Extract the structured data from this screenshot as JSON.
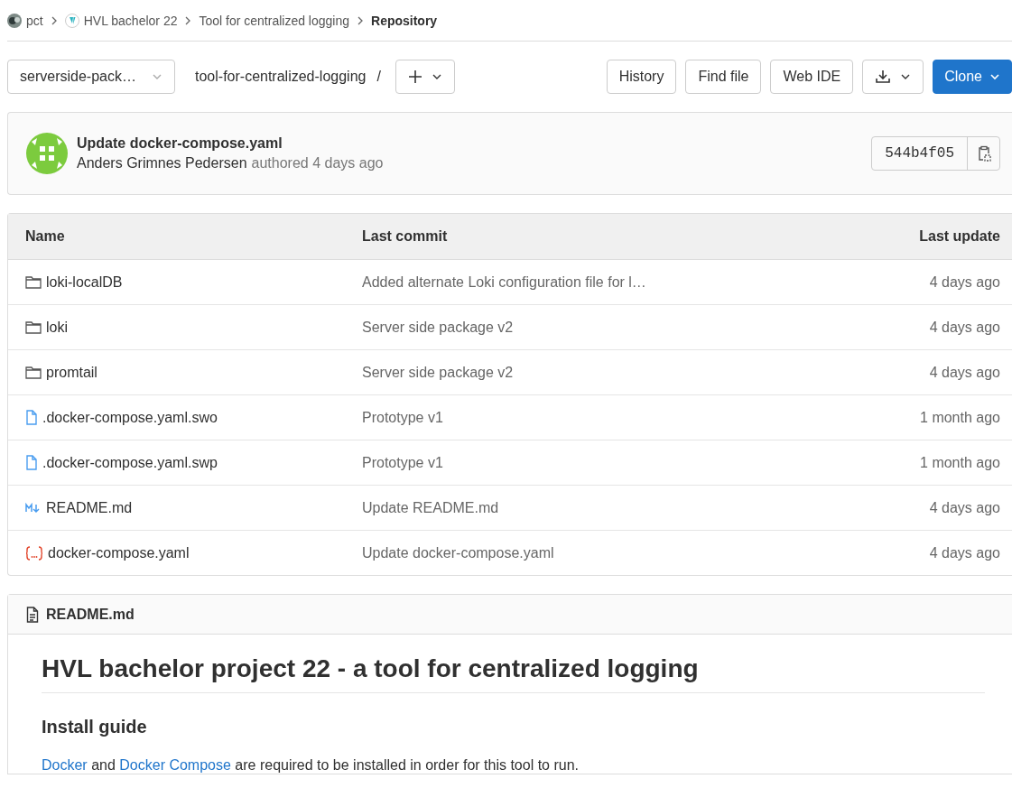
{
  "breadcrumbs": [
    {
      "label": "pct",
      "kind": "group",
      "current": false
    },
    {
      "label": "HVL bachelor 22",
      "kind": "project",
      "current": false
    },
    {
      "label": "Tool for centralized logging",
      "kind": "plain",
      "current": false
    },
    {
      "label": "Repository",
      "kind": "plain",
      "current": true
    }
  ],
  "toolbar": {
    "branch": "serverside-pack…",
    "path": "tool-for-centralized-logging",
    "separator": "/",
    "buttons": [
      "History",
      "Find file",
      "Web IDE"
    ],
    "clone": "Clone"
  },
  "commit": {
    "title": "Update docker-compose.yaml",
    "author": "Anders Grimnes Pedersen",
    "meta": "authored 4 days ago",
    "sha": "544b4f05"
  },
  "table": {
    "columns": [
      "Name",
      "Last commit",
      "Last update"
    ],
    "rows": [
      {
        "kind": "folder",
        "name": "loki-localDB",
        "commit": "Added alternate Loki configuration file for l…",
        "updated": "4 days ago"
      },
      {
        "kind": "folder",
        "name": "loki",
        "commit": "Server side package v2",
        "updated": "4 days ago"
      },
      {
        "kind": "folder",
        "name": "promtail",
        "commit": "Server side package v2",
        "updated": "4 days ago"
      },
      {
        "kind": "file",
        "name": ".docker-compose.yaml.swo",
        "commit": "Prototype v1",
        "updated": "1 month ago"
      },
      {
        "kind": "file",
        "name": ".docker-compose.yaml.swp",
        "commit": "Prototype v1",
        "updated": "1 month ago"
      },
      {
        "kind": "markdown",
        "name": "README.md",
        "commit": "Update README.md",
        "updated": "4 days ago"
      },
      {
        "kind": "yaml",
        "name": "docker-compose.yaml",
        "commit": "Update docker-compose.yaml",
        "updated": "4 days ago"
      }
    ]
  },
  "readme": {
    "filename": "README.md",
    "heading": "HVL bachelor project 22 - a tool for centralized logging",
    "subheading": "Install guide",
    "paragraph": [
      {
        "kind": "link",
        "text": "Docker"
      },
      {
        "kind": "text",
        "text": " and "
      },
      {
        "kind": "link",
        "text": "Docker Compose"
      },
      {
        "kind": "text",
        "text": " are required to be installed in order for this tool to run."
      }
    ]
  }
}
